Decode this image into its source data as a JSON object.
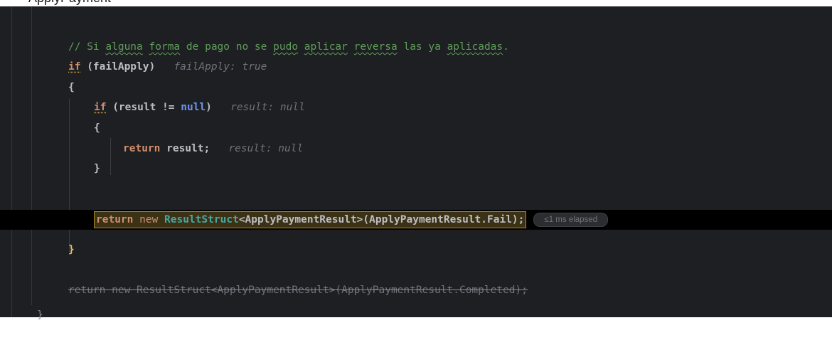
{
  "top_strip": {
    "text": "ApplyPayment"
  },
  "code": {
    "comment": {
      "prefix": "// Si ",
      "w1": "alguna",
      "s1": " ",
      "w2": "forma",
      "s2": " de pago no se ",
      "w3": "pudo",
      "s3": " ",
      "w4": "aplicar",
      "s4": " ",
      "w5": "reversa",
      "s5": " las ya ",
      "w6": "aplicadas",
      "suffix": "."
    },
    "if_fail": {
      "kw": "if",
      "rest": " (failApply)",
      "hint": "failApply: true"
    },
    "open_brace_outer": "{",
    "if_result": {
      "kw": "if",
      "open": " (result != ",
      "null_kw": "null",
      "close": ")",
      "hint": "result: null"
    },
    "open_brace_inner": "{",
    "return_result": {
      "kw": "return",
      "rest": " result;",
      "hint": "result: null"
    },
    "close_brace_inner": "}",
    "current_line": {
      "return_kw": "return",
      "new_kw": " new ",
      "cls": "ResultStruct",
      "rest": "<ApplyPaymentResult>(ApplyPaymentResult.Fail);",
      "elapsed": "≤1 ms elapsed"
    },
    "close_brace_outer": "}",
    "dead_line": "return new ResultStruct<ApplyPaymentResult>(ApplyPaymentResult.Completed);",
    "method_close": "}"
  },
  "colors": {
    "background": "#1e1f22",
    "keyword": "#cf8e6d",
    "comment": "#5f9e5a",
    "class": "#46a7a5",
    "hint": "#6f737a",
    "highlight_border": "#b38a1e"
  }
}
